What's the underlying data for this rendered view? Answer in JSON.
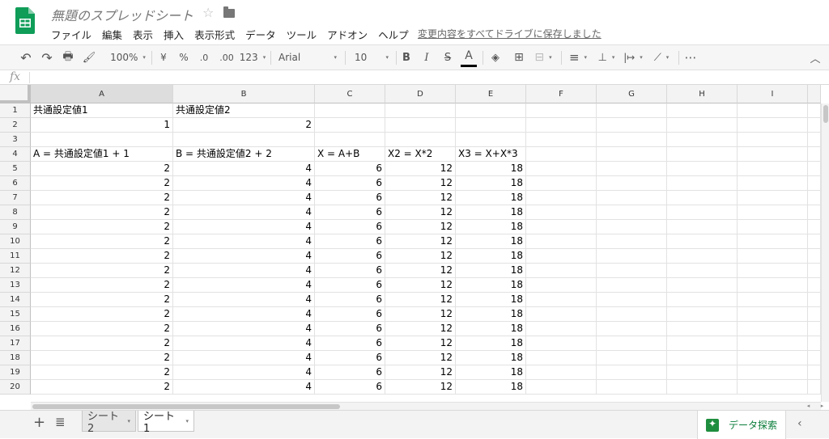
{
  "app": {
    "title": "無題のスプレッドシート",
    "save_status": "変更内容をすべてドライブに保存しました",
    "brand_color": "#0f9d58",
    "icons": {
      "star": "star-outline-icon",
      "folder": "folder-icon"
    }
  },
  "menu": {
    "items": [
      "ファイル",
      "編集",
      "表示",
      "挿入",
      "表示形式",
      "データ",
      "ツール",
      "アドオン",
      "ヘルプ"
    ]
  },
  "toolbar": {
    "undo_icon": "↶",
    "redo_icon": "↷",
    "print_icon": "🖶",
    "paint_format_icon": "🖌",
    "zoom": "100%",
    "currency": "¥",
    "percent": "%",
    "decrease_decimal": ".0",
    "increase_decimal": ".00",
    "more_formats": "123",
    "font": "Arial",
    "font_size": "10",
    "bold": "B",
    "italic": "I",
    "strikethrough": "S",
    "text_color": "A",
    "fill_color_icon": "◈",
    "borders_icon": "⊞",
    "merge_icon": "⊟",
    "align_icon": "≡",
    "valign_icon": "⊥",
    "wrap_icon": "|↦",
    "rotate_icon": "⟋",
    "more_icon": "⋯",
    "collapse_icon": "︿",
    "arrow": "▾"
  },
  "formula_bar": {
    "fx": "fx",
    "value": ""
  },
  "grid": {
    "columns": [
      "A",
      "B",
      "C",
      "D",
      "E",
      "F",
      "G",
      "H",
      "I"
    ],
    "rows": [
      [
        "共通設定値1",
        "共通設定値2",
        "",
        "",
        "",
        "",
        "",
        "",
        ""
      ],
      [
        "1",
        "2",
        "",
        "",
        "",
        "",
        "",
        "",
        ""
      ],
      [
        "",
        "",
        "",
        "",
        "",
        "",
        "",
        "",
        ""
      ],
      [
        "A = 共通設定値1 + 1",
        "B = 共通設定値2 + 2",
        "X = A+B",
        "X2 = X*2",
        "X3 = X+X*3",
        "",
        "",
        "",
        ""
      ],
      [
        "2",
        "4",
        "6",
        "12",
        "18",
        "",
        "",
        "",
        ""
      ],
      [
        "2",
        "4",
        "6",
        "12",
        "18",
        "",
        "",
        "",
        ""
      ],
      [
        "2",
        "4",
        "6",
        "12",
        "18",
        "",
        "",
        "",
        ""
      ],
      [
        "2",
        "4",
        "6",
        "12",
        "18",
        "",
        "",
        "",
        ""
      ],
      [
        "2",
        "4",
        "6",
        "12",
        "18",
        "",
        "",
        "",
        ""
      ],
      [
        "2",
        "4",
        "6",
        "12",
        "18",
        "",
        "",
        "",
        ""
      ],
      [
        "2",
        "4",
        "6",
        "12",
        "18",
        "",
        "",
        "",
        ""
      ],
      [
        "2",
        "4",
        "6",
        "12",
        "18",
        "",
        "",
        "",
        ""
      ],
      [
        "2",
        "4",
        "6",
        "12",
        "18",
        "",
        "",
        "",
        ""
      ],
      [
        "2",
        "4",
        "6",
        "12",
        "18",
        "",
        "",
        "",
        ""
      ],
      [
        "2",
        "4",
        "6",
        "12",
        "18",
        "",
        "",
        "",
        ""
      ],
      [
        "2",
        "4",
        "6",
        "12",
        "18",
        "",
        "",
        "",
        ""
      ],
      [
        "2",
        "4",
        "6",
        "12",
        "18",
        "",
        "",
        "",
        ""
      ],
      [
        "2",
        "4",
        "6",
        "12",
        "18",
        "",
        "",
        "",
        ""
      ],
      [
        "2",
        "4",
        "6",
        "12",
        "18",
        "",
        "",
        "",
        ""
      ],
      [
        "2",
        "4",
        "6",
        "12",
        "18",
        "",
        "",
        "",
        ""
      ]
    ],
    "selected_column": "A"
  },
  "sheets": {
    "add_icon": "+",
    "list_icon": "≣",
    "tabs": [
      {
        "label": "シート2",
        "active": false
      },
      {
        "label": "シート1",
        "active": true
      }
    ]
  },
  "explore": {
    "label": "データ探索",
    "collapse_icon": "‹"
  }
}
